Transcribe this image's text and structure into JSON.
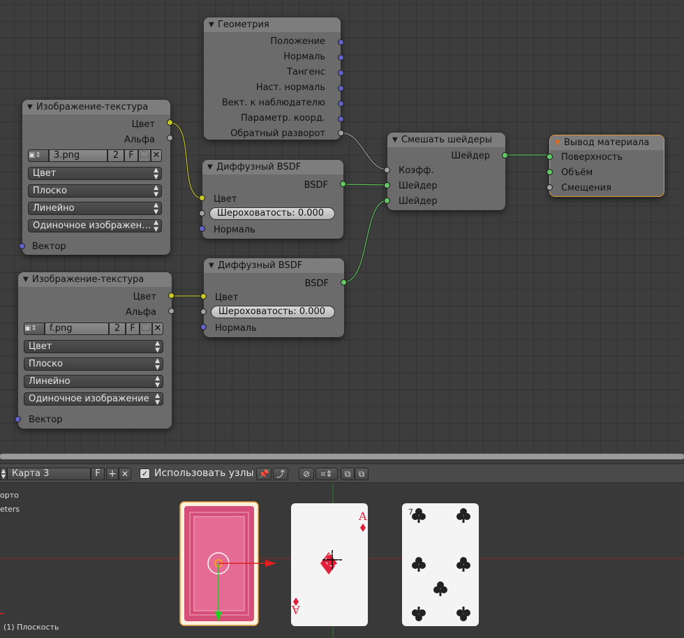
{
  "node_editor": {
    "geometry_node": {
      "title": "Геометрия",
      "outputs": [
        "Положение",
        "Нормаль",
        "Тангенс",
        "Наст. нормаль",
        "Вект. к наблюдателю",
        "Параметр. коорд.",
        "Обратный разворот"
      ]
    },
    "image_texture_1": {
      "title": "Изображение-текстура",
      "out_color": "Цвет",
      "out_alpha": "Альфа",
      "image_name": "3.png",
      "users": "2",
      "fake": "F",
      "color_mode": "Цвет",
      "projection": "Плоско",
      "interpolation": "Линейно",
      "source": "Одиночное изображен…",
      "in_vector": "Вектор"
    },
    "image_texture_2": {
      "title": "Изображение-текстура",
      "out_color": "Цвет",
      "out_alpha": "Альфа",
      "image_name": "f.png",
      "users": "2",
      "fake": "F",
      "color_mode": "Цвет",
      "projection": "Плоско",
      "interpolation": "Линейно",
      "source": "Одиночное изображение",
      "in_vector": "Вектор"
    },
    "diffuse_1": {
      "title": "Диффузный BSDF",
      "out_bsdf": "BSDF",
      "in_color": "Цвет",
      "roughness_label": "Шероховатость:",
      "roughness_value": "0.000",
      "in_normal": "Нормаль"
    },
    "diffuse_2": {
      "title": "Диффузный BSDF",
      "out_bsdf": "BSDF",
      "in_color": "Цвет",
      "roughness_label": "Шероховатость:",
      "roughness_value": "0.000",
      "in_normal": "Нормаль"
    },
    "mix_shader": {
      "title": "Смешать шейдеры",
      "out_shader": "Шейдер",
      "in_fac": "Коэфф.",
      "in_shader_1": "Шейдер",
      "in_shader_2": "Шейдер"
    },
    "material_output": {
      "title": "Вывод материала",
      "in_surface": "Поверхность",
      "in_volume": "Объём",
      "in_displacement": "Смещения"
    }
  },
  "header": {
    "material_name": "Карта 3",
    "fake_btn": "F",
    "use_nodes_label": "Использовать узлы",
    "use_nodes_checked": true
  },
  "viewport": {
    "label_1": "орто",
    "label_2": "eters",
    "object_label": "(1) Плоскость",
    "card_ace_rank": "A",
    "colors": {
      "card_back": "#d4507a",
      "diamond": "#e0203c",
      "club": "#222222"
    }
  }
}
